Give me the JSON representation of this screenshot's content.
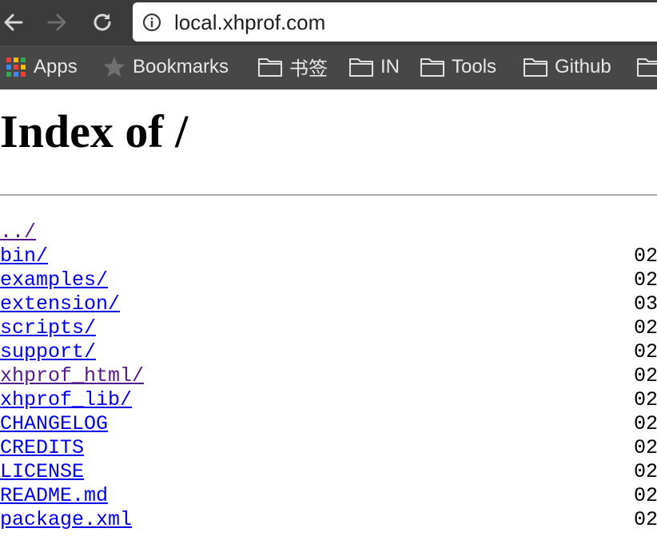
{
  "browser": {
    "url": "local.xhprof.com",
    "bookmarks": [
      {
        "label": "Apps",
        "icon": "apps-grid-icon"
      },
      {
        "label": "Bookmarks",
        "icon": "star-icon"
      },
      {
        "label": "书签",
        "icon": "folder-icon"
      },
      {
        "label": "IN",
        "icon": "folder-icon"
      },
      {
        "label": "Tools",
        "icon": "folder-icon"
      },
      {
        "label": "Github",
        "icon": "folder-icon"
      }
    ]
  },
  "page": {
    "title": "Index of /",
    "entries": [
      {
        "name": "../",
        "date": "",
        "visited": true
      },
      {
        "name": "bin/",
        "date": "02",
        "visited": false
      },
      {
        "name": "examples/",
        "date": "02",
        "visited": false
      },
      {
        "name": "extension/",
        "date": "03",
        "visited": false
      },
      {
        "name": "scripts/",
        "date": "02",
        "visited": false
      },
      {
        "name": "support/",
        "date": "02",
        "visited": false
      },
      {
        "name": "xhprof_html/",
        "date": "02",
        "visited": true
      },
      {
        "name": "xhprof_lib/",
        "date": "02",
        "visited": false
      },
      {
        "name": "CHANGELOG",
        "date": "02",
        "visited": false
      },
      {
        "name": "CREDITS",
        "date": "02",
        "visited": false
      },
      {
        "name": "LICENSE",
        "date": "02",
        "visited": false
      },
      {
        "name": "README.md",
        "date": "02",
        "visited": false
      },
      {
        "name": "package.xml",
        "date": "02",
        "visited": false
      }
    ]
  },
  "colors": {
    "link": "#0000ee",
    "visited_link": "#551a8b",
    "toolbar": "#3b3b3b",
    "bookmarks_bar": "#474747"
  }
}
